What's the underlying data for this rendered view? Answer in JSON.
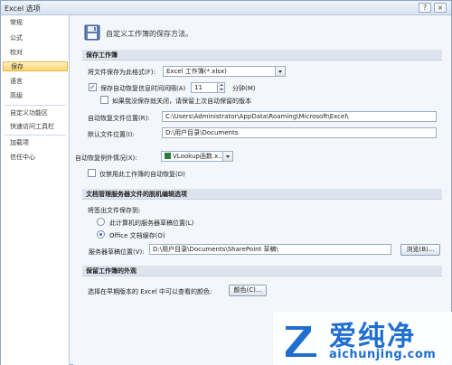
{
  "window": {
    "title": "Excel 选项",
    "help": "?",
    "close": "×"
  },
  "sidebar": {
    "items": [
      {
        "label": "常规"
      },
      {
        "label": "公式"
      },
      {
        "label": "校对"
      },
      {
        "label": "保存"
      },
      {
        "label": "语言"
      },
      {
        "label": "高级"
      },
      {
        "label": "自定义功能区"
      },
      {
        "label": "快速访问工具栏"
      },
      {
        "label": "加载项"
      },
      {
        "label": "信任中心"
      }
    ],
    "selected": "保存"
  },
  "header": {
    "text": "自定义工作簿的保存方法。"
  },
  "save_section": {
    "title": "保存工作簿",
    "format_label": "将文件保存为此格式(F):",
    "format_value": "Excel 工作簿(*.xlsx)",
    "autorecover_check": true,
    "autorecover_label": "保存自动恢复信息时间间隔(A)",
    "autorecover_minutes": "11",
    "minutes_unit": "分钟(M)",
    "keep_last_check": false,
    "keep_last_label": "如果我没保存就关闭，请保留上次自动保留的版本",
    "autorecover_location_label": "自动恢复文件位置(R):",
    "autorecover_location": "C:\\Users\\Administrator\\AppData\\Roaming\\Microsoft\\Excel\\",
    "default_location_label": "默认文件位置(I):",
    "default_location": "D:\\用户目录\\Documents"
  },
  "exception_section": {
    "label": "自动恢复例外情况(X):",
    "workbook": "VLookup函数.x...",
    "disable_check": false,
    "disable_label": "仅禁用此工作簿的自动恢复(D)"
  },
  "offline_section": {
    "title": "文档管理服务器文件的脱机编辑选项",
    "save_to_label": "将签出文件保存到:",
    "radio_server_label": "此计算机的服务器草稿位置(L)",
    "radio_server_selected": false,
    "radio_office_label": "Office 文档缓存(O)",
    "radio_office_selected": true,
    "drafts_label": "服务器草稿位置(V):",
    "drafts_location": "D:\\用户目录\\Documents\\SharePoint 草稿\\",
    "browse_label": "浏览(B)..."
  },
  "appearance_section": {
    "title": "保留工作簿的外观",
    "colors_label": "选择在早期版本的 Excel 中可以查看的颜色:",
    "colors_button": "颜色(C)..."
  },
  "watermark": {
    "brand_cn": "爱纯净",
    "brand_en": "aichunjing.com"
  },
  "colors": {
    "accent": "#1f6fd1",
    "selected_bg": "#ffd56a",
    "section_bg": "#dde4ee"
  }
}
